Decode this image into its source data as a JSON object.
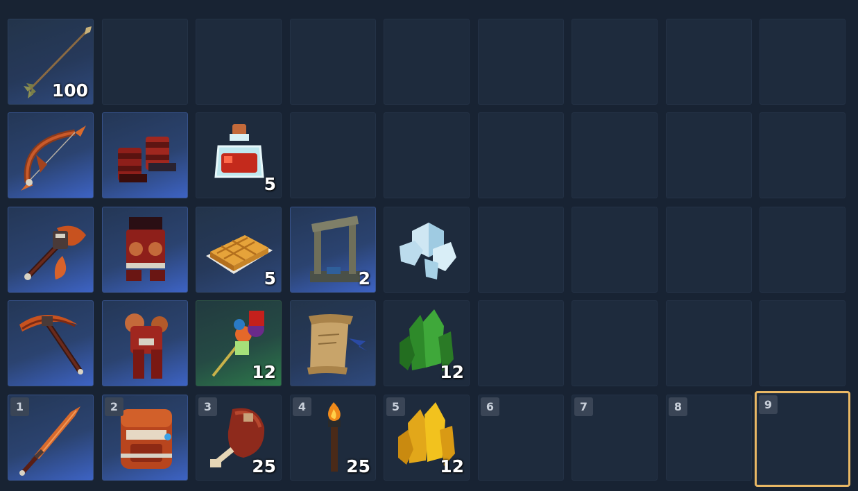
{
  "inventory": {
    "rows": [
      [
        {
          "item": "arrow-icon",
          "count": "100",
          "rarity": "common"
        },
        {},
        {},
        {},
        {},
        {},
        {},
        {},
        {}
      ],
      [
        {
          "item": "bow-icon",
          "rarity": "rare"
        },
        {
          "item": "boots-icon",
          "rarity": "rare"
        },
        {
          "item": "potion-icon",
          "count": "5"
        },
        {},
        {},
        {},
        {},
        {},
        {}
      ],
      [
        {
          "item": "axe-icon",
          "rarity": "rare"
        },
        {
          "item": "leggings-icon",
          "rarity": "rare"
        },
        {
          "item": "waffle-icon",
          "count": "5",
          "rarity": "common"
        },
        {
          "item": "doorframe-icon",
          "count": "2",
          "rarity": "rare"
        },
        {
          "item": "ice-crystal-icon"
        },
        {},
        {},
        {},
        {}
      ],
      [
        {
          "item": "pickaxe-icon",
          "rarity": "rare"
        },
        {
          "item": "chestplate-icon",
          "rarity": "rare"
        },
        {
          "item": "flower-staff-icon",
          "count": "12",
          "rarity": "uncommon"
        },
        {
          "item": "scroll-icon",
          "rarity": "common"
        },
        {
          "item": "green-crystal-icon",
          "count": "12"
        },
        {},
        {},
        {},
        {}
      ]
    ],
    "hotbar": [
      {
        "key": "1",
        "item": "sword-icon",
        "rarity": "rare"
      },
      {
        "key": "2",
        "item": "helmet-icon",
        "rarity": "rare"
      },
      {
        "key": "3",
        "item": "meat-icon",
        "count": "25"
      },
      {
        "key": "4",
        "item": "torch-icon",
        "count": "25"
      },
      {
        "key": "5",
        "item": "gold-crystal-icon",
        "count": "12"
      },
      {
        "key": "6"
      },
      {
        "key": "7"
      },
      {
        "key": "8"
      },
      {
        "key": "9",
        "selected": true
      }
    ]
  },
  "colors": {
    "background": "#182333",
    "slot": "#1e2b3d",
    "rare_glow": "#3d63c4",
    "uncommon_glow": "#2d7a4a",
    "selection": "#e9b865"
  }
}
